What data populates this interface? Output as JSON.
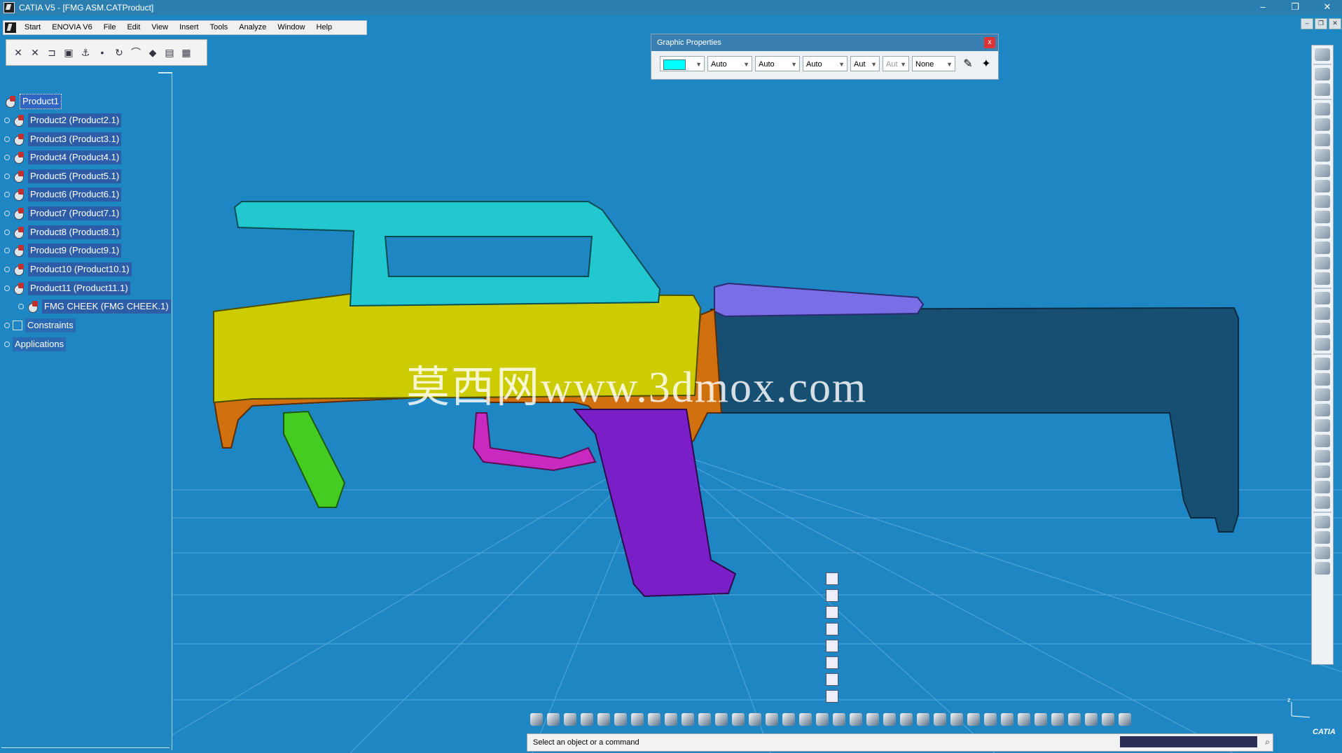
{
  "window": {
    "title": "CATIA V5 - [FMG ASM.CATProduct]",
    "minimize": "–",
    "restore": "❐",
    "close": "✕"
  },
  "menu": [
    "Start",
    "ENOVIA V6",
    "File",
    "Edit",
    "View",
    "Insert",
    "Tools",
    "Analyze",
    "Window",
    "Help"
  ],
  "tree": {
    "root": "Product1",
    "items": [
      "Product2 (Product2.1)",
      "Product3 (Product3.1)",
      "Product4 (Product4.1)",
      "Product5 (Product5.1)",
      "Product6 (Product6.1)",
      "Product7 (Product7.1)",
      "Product8 (Product8.1)",
      "Product9 (Product9.1)",
      "Product10 (Product10.1)",
      "Product11 (Product11.1)"
    ],
    "child": "FMG CHEEK (FMG CHEEK.1)",
    "constraints": "Constraints",
    "applications": "Applications"
  },
  "graphic_properties": {
    "title": "Graphic Properties",
    "close": "x",
    "fill_color": "#00ffff",
    "transparency": "Auto",
    "line_thickness": "Auto",
    "line_type": "Auto",
    "point_symbol": "Aut",
    "point_disabled": "Aut",
    "layer": "None"
  },
  "viewport": {
    "watermark": "莫西网www.3dmox.com",
    "part_colors": {
      "sight": "#22c8cf",
      "receiver": "#cccc00",
      "frame": "#d0700f",
      "stock": "#174f72",
      "cheek": "#7a6ee6",
      "grip": "#7a1fc8",
      "foregrip": "#44cc22",
      "trigger": "#c82ac0"
    }
  },
  "status": {
    "message": "Select an object or a command"
  },
  "doc_buttons": [
    "–",
    "❐",
    "✕"
  ],
  "axis_label": "z",
  "logo_text": "CATIA"
}
